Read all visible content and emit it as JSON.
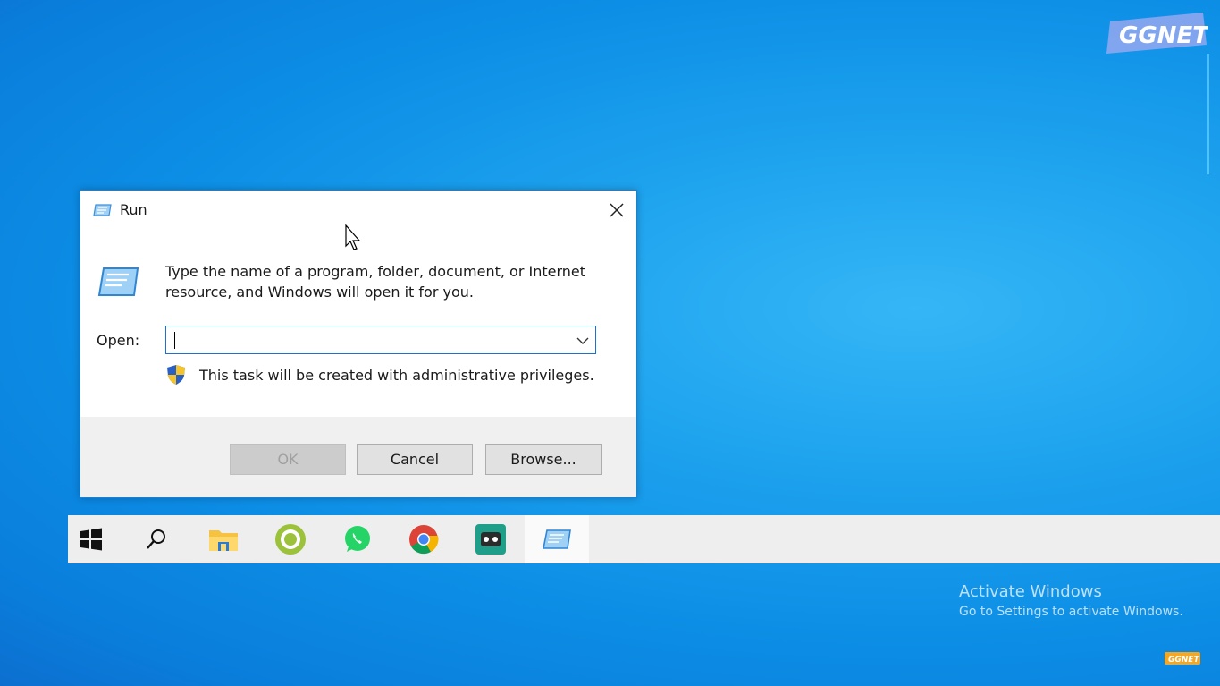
{
  "dialog": {
    "title": "Run",
    "icon": "run-icon",
    "description": "Type the name of a program, folder, document, or Internet resource, and Windows will open it for you.",
    "open_label": "Open:",
    "open_value": "",
    "admin_note": "This task will be created with administrative privileges.",
    "buttons": {
      "ok": "OK",
      "cancel": "Cancel",
      "browse": "Browse..."
    }
  },
  "taskbar": {
    "items": [
      {
        "icon": "windows-start-icon"
      },
      {
        "icon": "search-icon"
      },
      {
        "icon": "file-explorer-icon"
      },
      {
        "icon": "messenger-app-icon"
      },
      {
        "icon": "whatsapp-icon"
      },
      {
        "icon": "chrome-icon"
      },
      {
        "icon": "game-app-icon"
      },
      {
        "icon": "run-icon",
        "active": true
      }
    ]
  },
  "watermark": {
    "title": "Activate Windows",
    "subtitle": "Go to Settings to activate Windows.",
    "logo": "GGNET"
  },
  "colors": {
    "desktop": "#1ea3ee",
    "accent": "#1f6fcf",
    "taskbar": "#eeeeee"
  }
}
